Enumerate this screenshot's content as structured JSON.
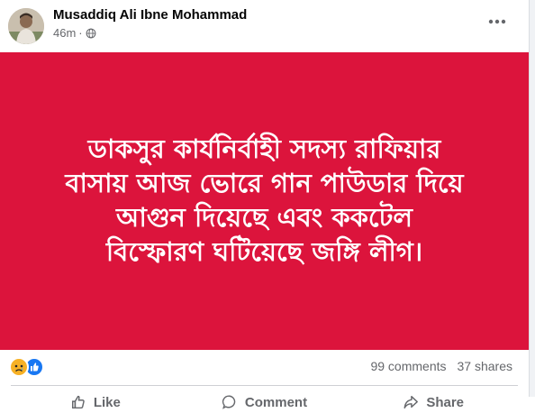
{
  "post": {
    "author": "Musaddiq Ali Ibne Mohammad",
    "time": "46m",
    "privacy_icon": "globe-icon",
    "banner": {
      "background": "#dc143c",
      "lines": [
        "ডাকসুর কার্যনির্বাহী সদস্য রাফিয়ার",
        "বাসায় আজ ভোরে গান পাউডার দিয়ে",
        "আগুন দিয়েছে এবং ককটেল",
        "বিস্ফোরণ ঘটিয়েছে জঙ্গি লীগ।"
      ]
    },
    "reactions": [
      "sad-reaction-icon",
      "like-reaction-icon"
    ],
    "comments": "99 comments",
    "shares": "37 shares",
    "actions": {
      "like": "Like",
      "comment": "Comment",
      "share": "Share"
    }
  }
}
